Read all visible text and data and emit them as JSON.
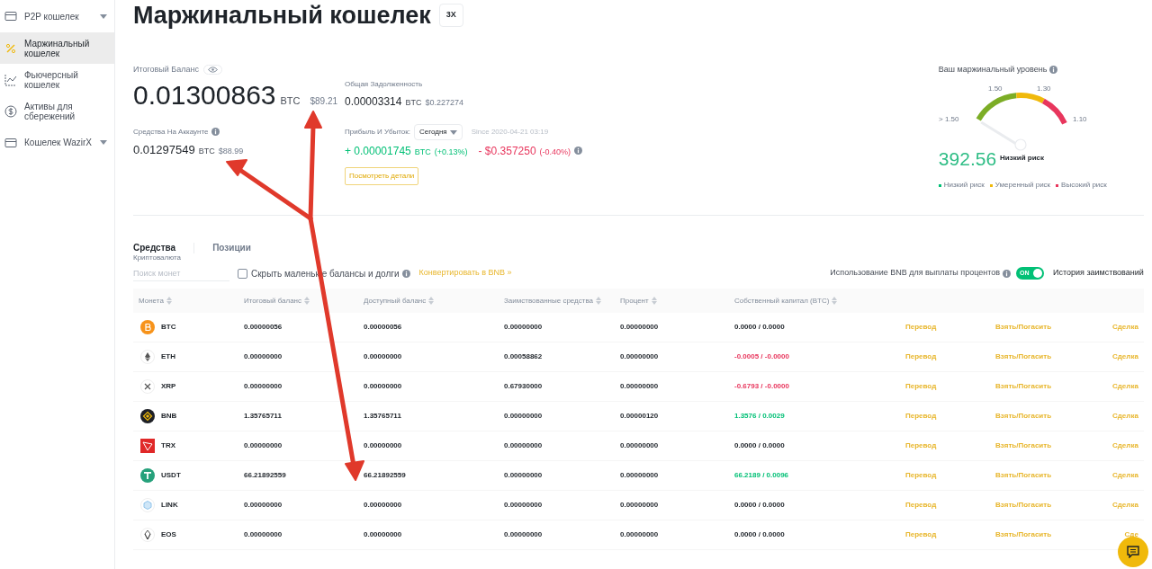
{
  "sidebar": {
    "items": [
      {
        "label": "P2P кошелек",
        "kind": "group",
        "selected": false,
        "expanded": false
      },
      {
        "label": "Маржинальный кошелек",
        "kind": "link",
        "selected": true
      },
      {
        "label": "Фьючерсный кошелек",
        "kind": "link",
        "selected": false
      },
      {
        "label": "Активы для сбережений",
        "kind": "link",
        "selected": false
      },
      {
        "label": "Кошелек WazirX",
        "kind": "group",
        "selected": false,
        "expanded": false
      }
    ]
  },
  "header": {
    "title": "Маржинальный кошелек",
    "badge": "3X"
  },
  "balance": {
    "label": "Итоговый Баланс",
    "value": "0.01300863",
    "unit": "BTC",
    "usd": "$89.21"
  },
  "account": {
    "label": "Средства На Аккаунте",
    "value": "0.01297549",
    "unit": "BTC",
    "usd": "$88.99"
  },
  "debt": {
    "label": "Общая Задолженность",
    "value": "0.00003314",
    "unit": "BTC",
    "usd": "$0.227274"
  },
  "pnl": {
    "label": "Прибыль И Убыток:",
    "period": "Сегодня",
    "since": "Since 2020-04-21 03:19",
    "btc_change": "+ 0.00001745",
    "btc_unit": "BTC",
    "btc_pct": "(+0.13%)",
    "usd_change": "- $0.357250",
    "usd_pct": "(-0.40%)",
    "details_button": "Посмотреть детали"
  },
  "margin": {
    "label": "Ваш маржинальный уровень",
    "ticks": [
      "> 1.50",
      "1.50",
      "1.30",
      "1.10"
    ],
    "value": "392.56",
    "risk": "Низкий риск",
    "legend": [
      {
        "label": "Низкий риск",
        "color": "#02c076"
      },
      {
        "label": "Умеренный риск",
        "color": "#f0b90b"
      },
      {
        "label": "Высокий риск",
        "color": "#e8365d"
      }
    ]
  },
  "tabs": [
    {
      "label": "Средства",
      "selected": true
    },
    {
      "label": "Позиции",
      "selected": false
    }
  ],
  "subtitle": "Криптовалюта",
  "filters": {
    "search_placeholder": "Поиск монет",
    "hide_small": {
      "label": "Скрыть маленьк е балансы и долги",
      "checked": false
    },
    "convert_link": "Конвертировать в BNB »",
    "bnb_interest": {
      "label": "Использование BNB для выплаты процентов",
      "on": true,
      "toggle_label": "ON"
    },
    "history_link": "История заимствований"
  },
  "table": {
    "columns": [
      "Монета",
      "Итоговый баланс",
      "Доступный баланс",
      "Заимствованные средства",
      "Процент",
      "Собственный капитал (BTC)"
    ],
    "rows": [
      {
        "coin": "BTC",
        "total": "0.00000056",
        "available": "0.00000056",
        "borrowed": "0.00000000",
        "interest": "0.00000000",
        "equity": {
          "value": "0.0000 / 0.0000",
          "color": "#1e2329"
        },
        "actions": [
          "Перевод",
          "Взять/Погасить",
          "Сделка"
        ]
      },
      {
        "coin": "ETH",
        "total": "0.00000000",
        "available": "0.00000000",
        "borrowed": "0.00058862",
        "interest": "0.00000000",
        "equity": {
          "value": "-0.0005 / -0.0000",
          "color": "#e8365d"
        },
        "actions": [
          "Перевод",
          "Взять/Погасить",
          "Сделка"
        ]
      },
      {
        "coin": "XRP",
        "total": "0.00000000",
        "available": "0.00000000",
        "borrowed": "0.67930000",
        "interest": "0.00000000",
        "equity": {
          "value": "-0.6793 / -0.0000",
          "color": "#e8365d"
        },
        "actions": [
          "Перевод",
          "Взять/Погасить",
          "Сделка"
        ]
      },
      {
        "coin": "BNB",
        "total": "1.35765711",
        "available": "1.35765711",
        "borrowed": "0.00000000",
        "interest": "0.00000120",
        "equity": {
          "value": "1.3576 / 0.0029",
          "color": "#02c076"
        },
        "actions": [
          "Перевод",
          "Взять/Погасить",
          "Сделка"
        ]
      },
      {
        "coin": "TRX",
        "total": "0.00000000",
        "available": "0.00000000",
        "borrowed": "0.00000000",
        "interest": "0.00000000",
        "equity": {
          "value": "0.0000 / 0.0000",
          "color": "#1e2329"
        },
        "actions": [
          "Перевод",
          "Взять/Погасить",
          "Сделка"
        ]
      },
      {
        "coin": "USDT",
        "total": "66.21892559",
        "available": "66.21892559",
        "borrowed": "0.00000000",
        "interest": "0.00000000",
        "equity": {
          "value": "66.2189 / 0.0096",
          "color": "#02c076"
        },
        "actions": [
          "Перевод",
          "Взять/Погасить",
          "Сделка"
        ]
      },
      {
        "coin": "LINK",
        "total": "0.00000000",
        "available": "0.00000000",
        "borrowed": "0.00000000",
        "interest": "0.00000000",
        "equity": {
          "value": "0.0000 / 0.0000",
          "color": "#1e2329"
        },
        "actions": [
          "Перевод",
          "Взять/Погасить",
          "Сделка"
        ]
      },
      {
        "coin": "EOS",
        "total": "0.00000000",
        "available": "0.00000000",
        "borrowed": "0.00000000",
        "interest": "0.00000000",
        "equity": {
          "value": "0.0000 / 0.0000",
          "color": "#1e2329"
        },
        "actions": [
          "Перевод",
          "Взять/Погасить",
          "Сде"
        ]
      }
    ]
  }
}
